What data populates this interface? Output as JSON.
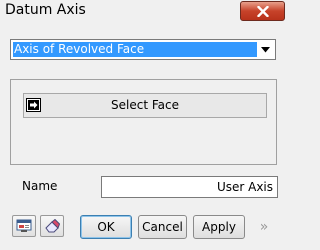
{
  "window": {
    "title": "Datum Axis"
  },
  "mode_select": {
    "value": "Axis of Revolved Face"
  },
  "select_face": {
    "label": "Select Face"
  },
  "name_field": {
    "label": "Name",
    "value": "User Axis"
  },
  "buttons": {
    "ok": "OK",
    "cancel": "Cancel",
    "apply": "Apply",
    "expand": "»"
  },
  "icons": {
    "close": "close-icon",
    "dropdown": "chevron-down-icon",
    "select": "selection-arrow-icon",
    "preview": "preview-icon",
    "eraser": "eraser-icon"
  }
}
